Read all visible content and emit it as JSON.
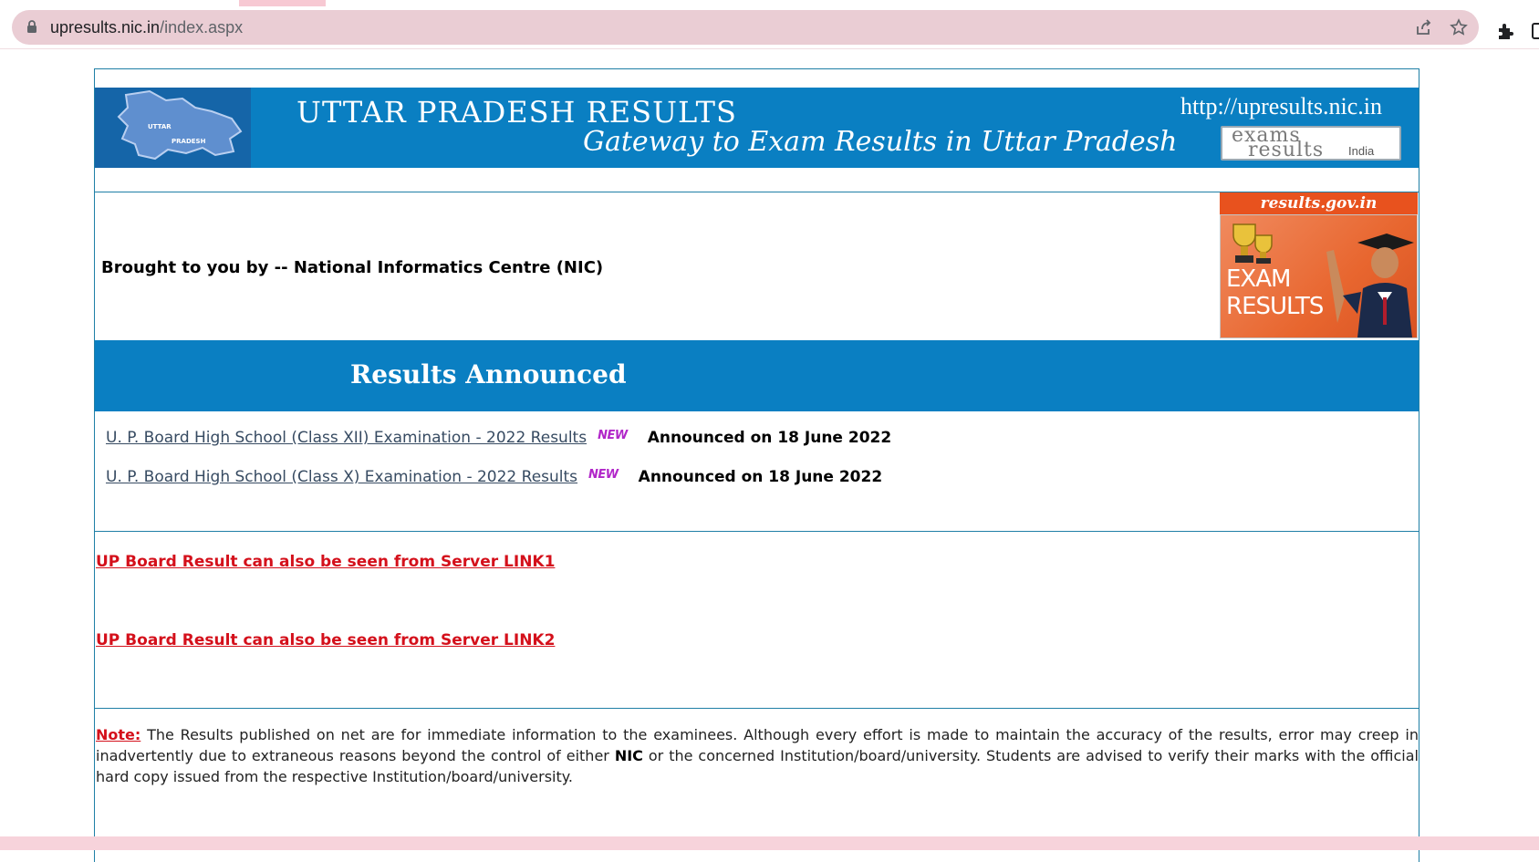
{
  "browser": {
    "url_host": "upresults.nic.in",
    "url_path": "/index.aspx"
  },
  "banner": {
    "map_text_1": "UTTAR",
    "map_text_2": "PRADESH",
    "title": "UTTAR PRADESH RESULTS",
    "subtitle": "Gateway to Exam Results in Uttar Pradesh",
    "site_url": "http://upresults.nic.in",
    "logo_word_1": "exams",
    "logo_word_2": "results",
    "logo_word_3": "India"
  },
  "credit": "Brought to you by -- National Informatics Centre (NIC)",
  "side_banner": {
    "header": "results.gov.in",
    "line1": "EXAM",
    "line2": "RESULTS"
  },
  "announce_heading": "Results Announced",
  "results": [
    {
      "label": "U. P. Board High School (Class XII) Examination - 2022 Results",
      "badge": "NEW",
      "date": "Announced on 18 June 2022"
    },
    {
      "label": "U. P. Board High School (Class X) Examination - 2022 Results",
      "badge": "NEW",
      "date": "Announced on 18 June 2022"
    }
  ],
  "server_links": [
    "UP Board Result can also be seen from Server LINK1",
    "UP Board Result can also be seen from Server LINK2"
  ],
  "note": {
    "label": "Note:",
    "text_1": " The Results published on net are for immediate information to the examinees. Although every effort is made to maintain the accuracy of the results, error may creep in inadvertently due to extraneous reasons beyond the control of either ",
    "bold": "NIC",
    "text_2": " or the concerned Institution/board/university. Students are advised to verify their marks with the official hard copy issued from the respective Institution/board/university."
  },
  "colors": {
    "banner_blue": "#0a7fc2",
    "link_red": "#d4101b",
    "border_blue": "#1f7fa6",
    "badge_orange": "#e8521e"
  }
}
